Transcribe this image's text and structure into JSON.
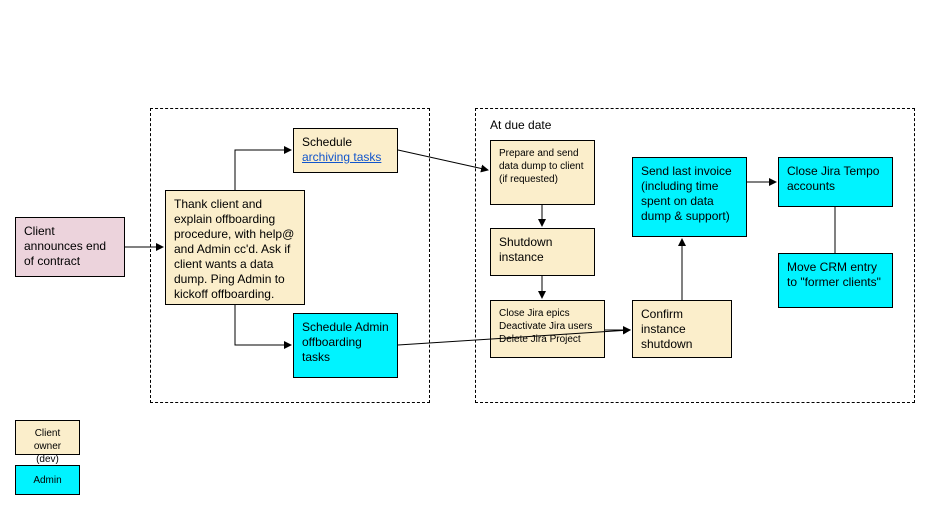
{
  "nodes": {
    "client_announce": "Client announces end of contract",
    "thank_client": "Thank client and explain offboarding procedure, with help@ and Admin cc'd. Ask if client wants a data dump. Ping Admin to kickoff offboarding.",
    "schedule_arch_prefix": "Schedule ",
    "schedule_arch_link": "archiving tasks",
    "schedule_admin": "Schedule Admin offboarding tasks",
    "due_title": "At due date",
    "prepare_dump": "Prepare and send data dump to client (if requested)",
    "shutdown": "Shutdown instance",
    "close_jira": "Close Jira epics\nDeactivate Jira users\nDelete Jira Project",
    "confirm_shutdown": "Confirm instance shutdown",
    "send_invoice": "Send last invoice (including time spent on data dump & support)",
    "close_tempo": "Close Jira Tempo accounts",
    "move_crm": "Move CRM entry to \"former clients\""
  },
  "legend": {
    "owner": "Client owner (dev)",
    "admin": "Admin"
  }
}
